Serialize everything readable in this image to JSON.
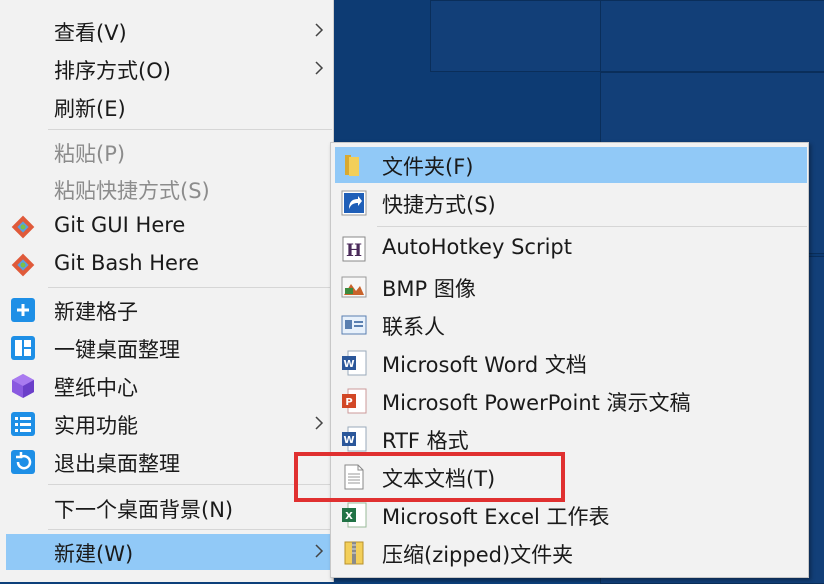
{
  "main_menu": {
    "items": [
      {
        "label": "查看(V)",
        "has_submenu": true
      },
      {
        "label": "排序方式(O)",
        "has_submenu": true
      },
      {
        "label": "刷新(E)"
      },
      {
        "label": "粘贴(P)",
        "disabled": true
      },
      {
        "label": "粘贴快捷方式(S)",
        "disabled": true
      },
      {
        "label": "Git GUI Here"
      },
      {
        "label": "Git Bash Here"
      },
      {
        "label": "新建格子"
      },
      {
        "label": "一键桌面整理"
      },
      {
        "label": "壁纸中心"
      },
      {
        "label": "实用功能",
        "has_submenu": true
      },
      {
        "label": "退出桌面整理"
      },
      {
        "label": "下一个桌面背景(N)"
      },
      {
        "label": "新建(W)",
        "has_submenu": true,
        "active": true
      }
    ]
  },
  "new_submenu": {
    "items": [
      {
        "label": "文件夹(F)",
        "icon": "folder-icon",
        "active": true
      },
      {
        "label": "快捷方式(S)",
        "icon": "shortcut-icon"
      },
      {
        "label": "AutoHotkey Script",
        "icon": "autohotkey-icon"
      },
      {
        "label": "BMP 图像",
        "icon": "bmp-image-icon"
      },
      {
        "label": "联系人",
        "icon": "contact-icon"
      },
      {
        "label": "Microsoft Word 文档",
        "icon": "word-icon"
      },
      {
        "label": "Microsoft PowerPoint 演示文稿",
        "icon": "powerpoint-icon"
      },
      {
        "label": "RTF 格式",
        "icon": "rtf-icon"
      },
      {
        "label": "文本文档(T)",
        "icon": "text-document-icon",
        "highlighted": true
      },
      {
        "label": "Microsoft Excel 工作表",
        "icon": "excel-icon"
      },
      {
        "label": "压缩(zipped)文件夹",
        "icon": "zip-folder-icon"
      }
    ]
  },
  "colors": {
    "menu_bg": "#f2f2f2",
    "hover": "#91c9f7",
    "highlight_border": "#e03030",
    "desktop": "#0d3b73"
  }
}
